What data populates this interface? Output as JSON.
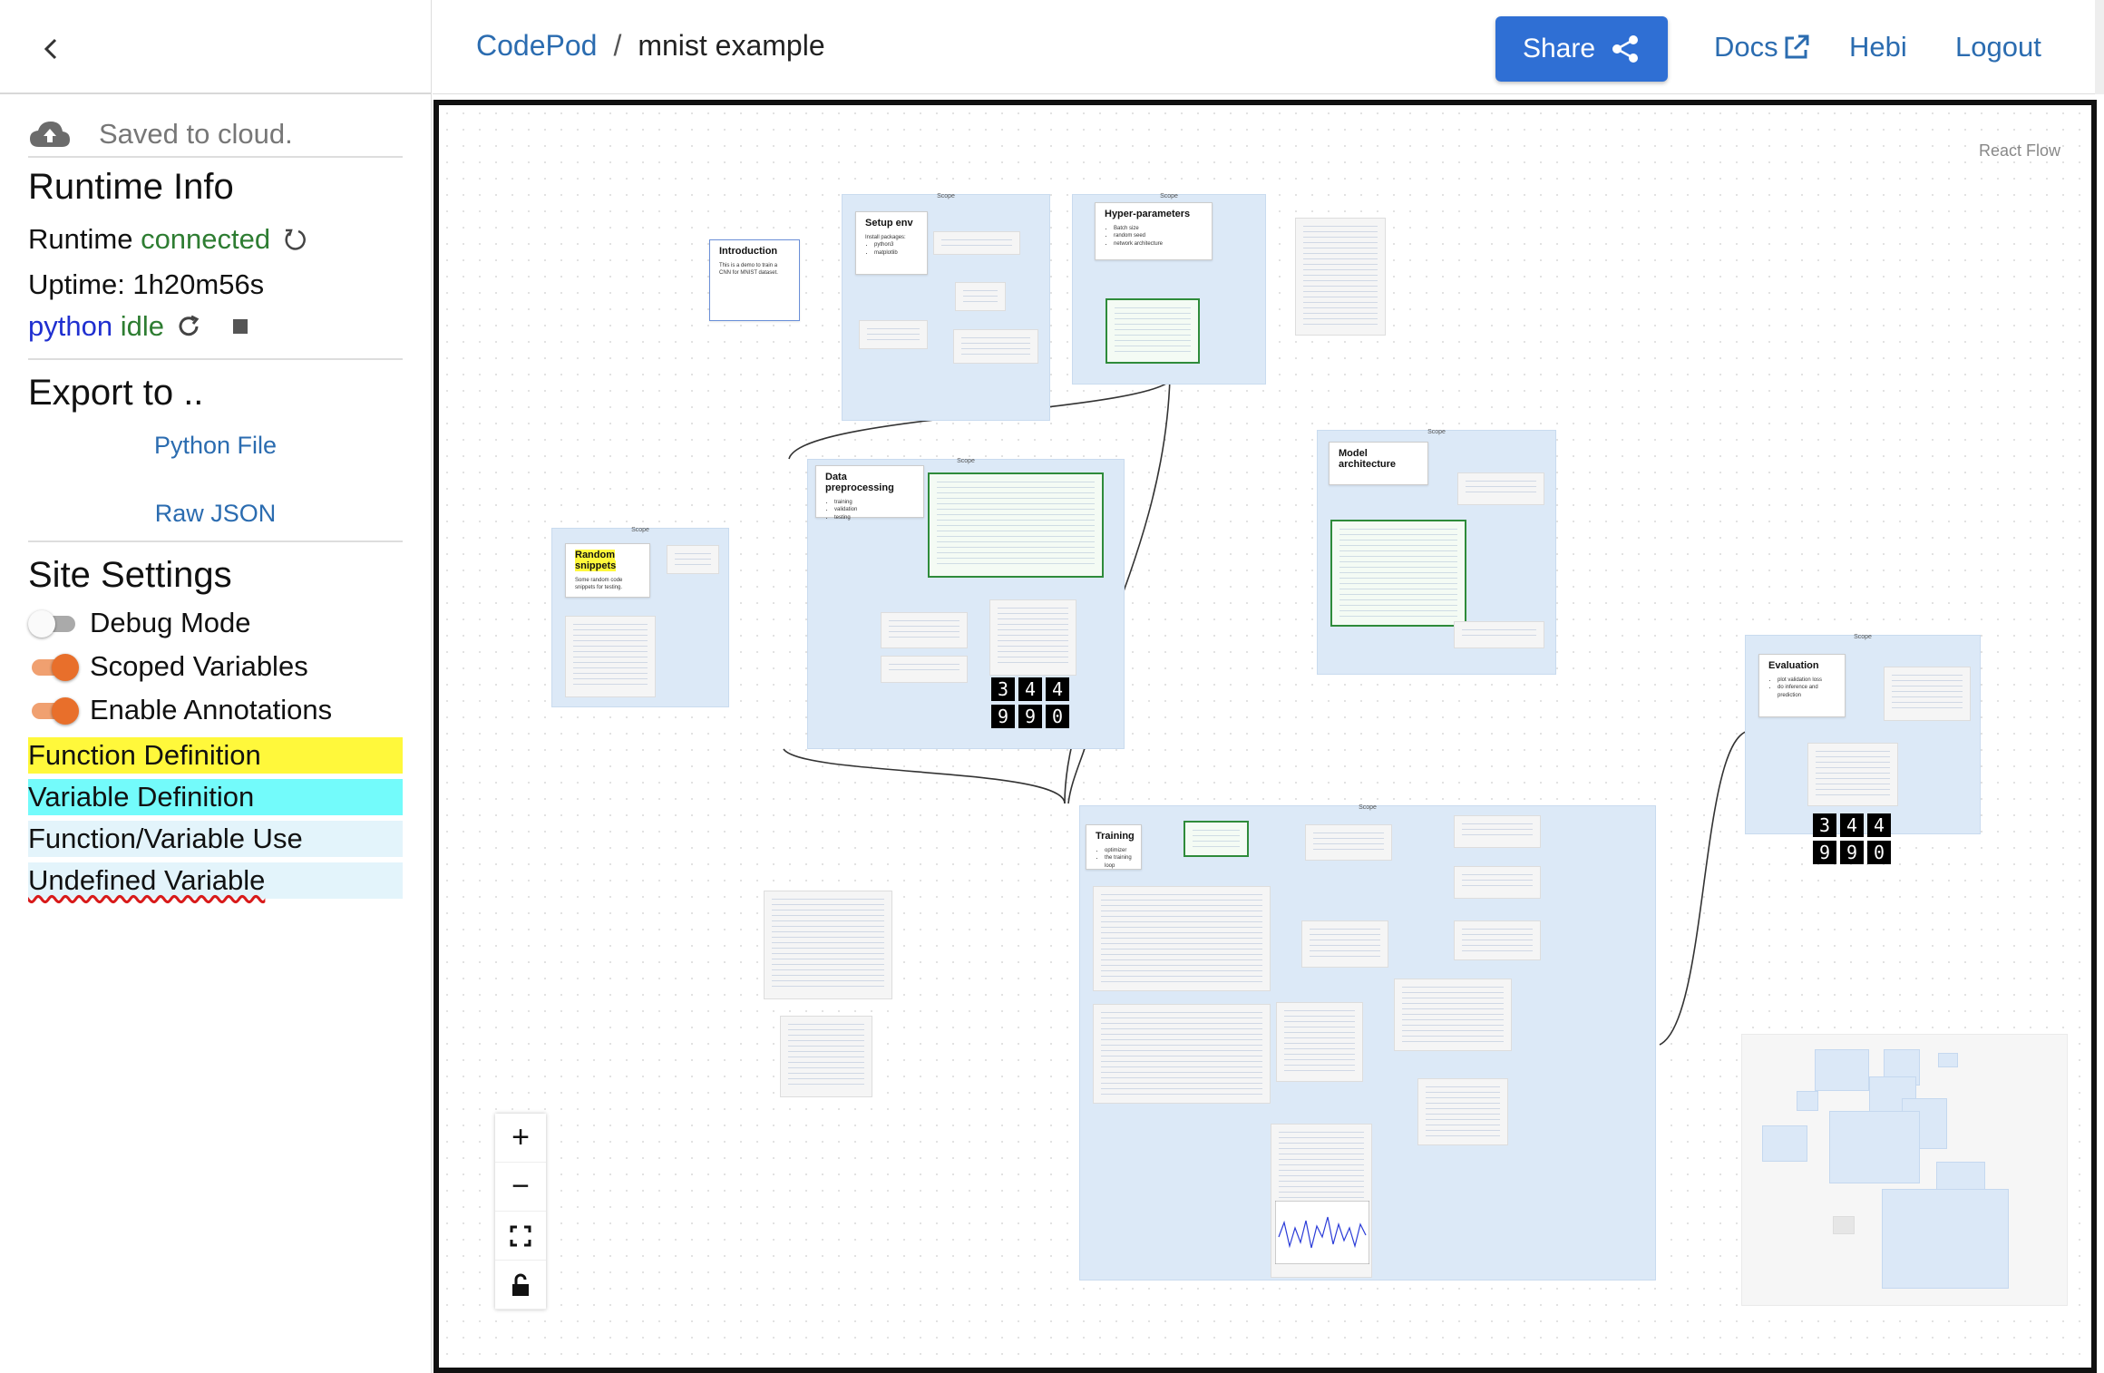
{
  "sidebar": {
    "saved_status": "Saved to cloud.",
    "runtime_title": "Runtime Info",
    "runtime_label": "Runtime",
    "runtime_status": "connected",
    "uptime": "Uptime: 1h20m56s",
    "kernel_name": "python",
    "kernel_status": "idle",
    "export_title": "Export to ..",
    "export_python": "Python File",
    "export_json": "Raw JSON",
    "settings_title": "Site Settings",
    "toggles": [
      {
        "label": "Debug Mode",
        "on": false
      },
      {
        "label": "Scoped Variables",
        "on": true
      },
      {
        "label": "Enable Annotations",
        "on": true
      }
    ],
    "legend": [
      {
        "label": "Function Definition",
        "color": "#fff83b"
      },
      {
        "label": "Variable Definition",
        "color": "#73fbfb"
      },
      {
        "label": "Function/Variable Use",
        "color": "#e3f4fb"
      },
      {
        "label": "Undefined Variable",
        "color": "#e3f4fb"
      }
    ]
  },
  "header": {
    "app_name": "CodePod",
    "separator": "/",
    "repo_name": "mnist example",
    "share_label": "Share",
    "docs_label": "Docs",
    "user_label": "Hebi",
    "logout_label": "Logout"
  },
  "canvas": {
    "watermark": "React Flow",
    "scope_label": "Scope",
    "notes": {
      "introduction": "Introduction",
      "intro_text": "This is a demo to train a CNN for MNIST dataset.",
      "setup_env": "Setup env",
      "setup_text": "Install packages:",
      "setup_items": [
        "python3",
        "matplotlib"
      ],
      "hyper": "Hyper-parameters",
      "hyper_items": [
        "Batch size",
        "random seed",
        "network architecture"
      ],
      "data_pre": "Data preprocessing",
      "data_items": [
        "training",
        "validation",
        "testing"
      ],
      "model_arch": "Model architecture",
      "random_snippets": "Random snippets",
      "random_text": "Some random code snippets for testing.",
      "training": "Training",
      "training_items": [
        "optimizer",
        "the training loop"
      ],
      "evaluation": "Evaluation",
      "eval_items": [
        "plot validation loss",
        "do inference and prediction"
      ]
    },
    "digits_row1": [
      "3",
      "4",
      "4"
    ],
    "digits_row2": [
      "9",
      "9",
      "0"
    ]
  },
  "colors": {
    "accent": "#2f6fd4",
    "connected": "#2e7d32",
    "kernel": "#1f2fd0",
    "toggle_on": "#e86f2b",
    "scope_bg": "#dce9f7"
  },
  "icons": [
    "chevron-left-icon",
    "cloud-upload-icon",
    "refresh-icon",
    "stop-icon",
    "share-icon",
    "external-link-icon",
    "zoom-in-icon",
    "zoom-out-icon",
    "fit-view-icon",
    "lock-icon"
  ]
}
